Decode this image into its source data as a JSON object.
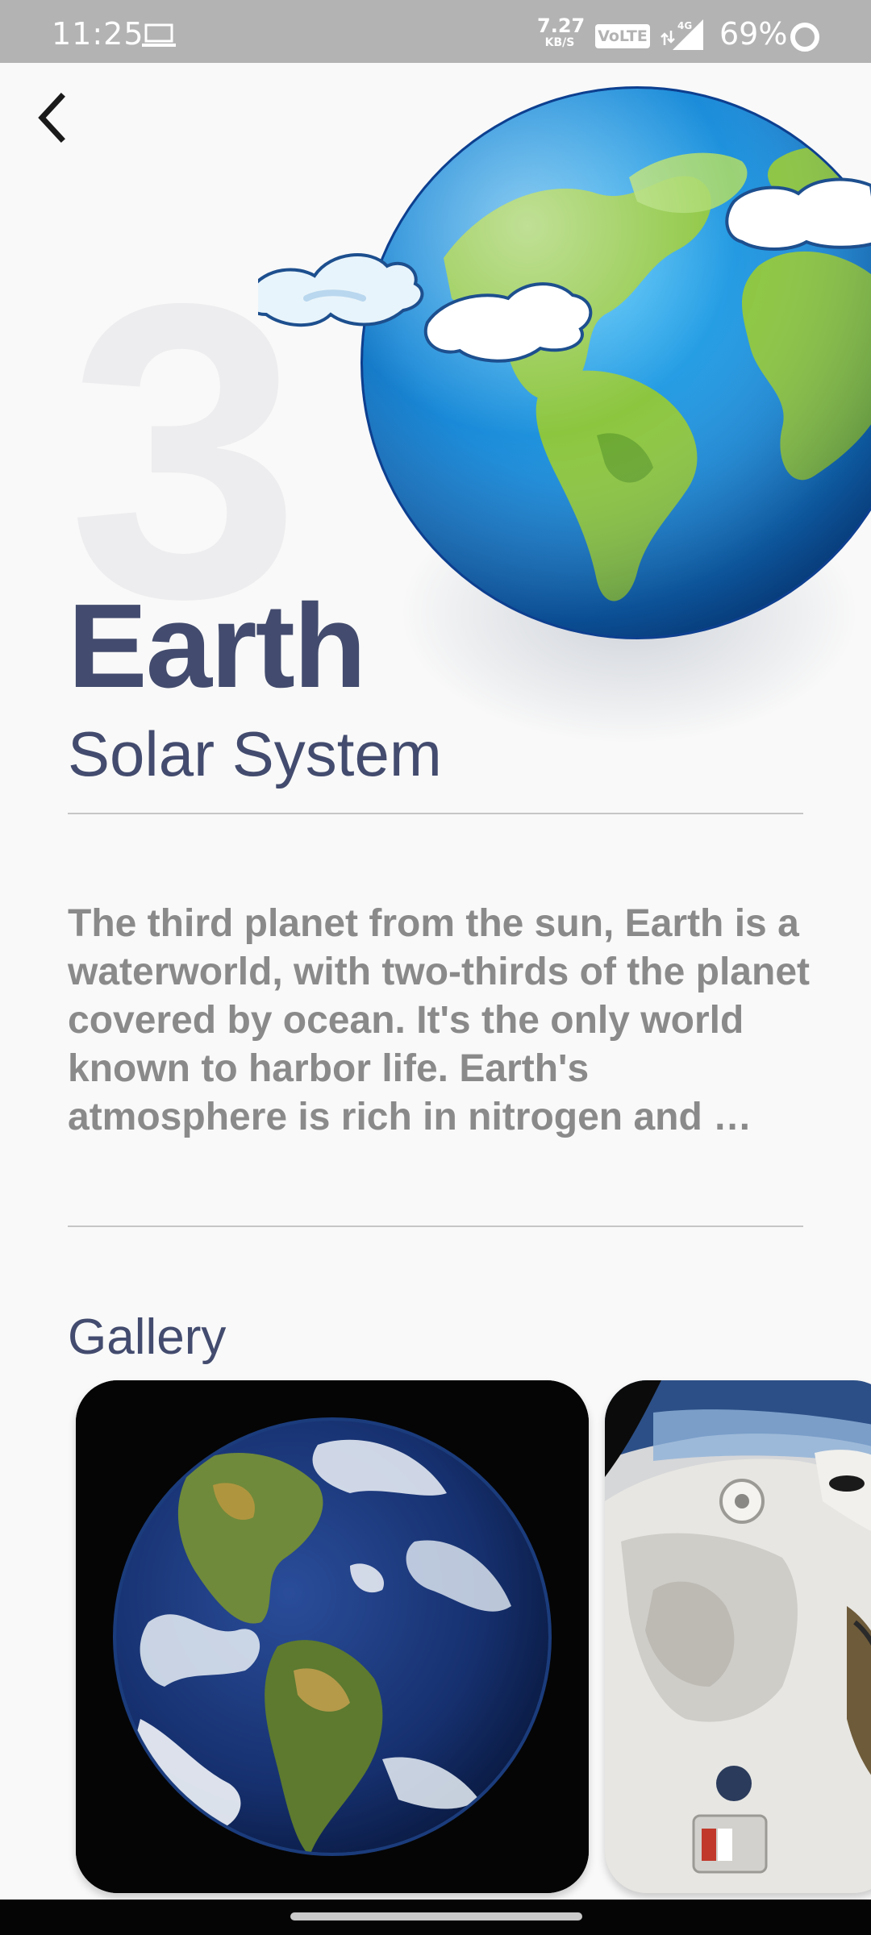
{
  "status_bar": {
    "time": "11:25",
    "net_speed_value": "7.27",
    "net_speed_unit": "KB/S",
    "volte": "VoLTE",
    "network": "4G",
    "battery": "69%",
    "icons": [
      "laptop-icon",
      "signal-icon",
      "battery-ring-icon"
    ]
  },
  "header": {
    "back_icon": "chevron-left-icon"
  },
  "planet": {
    "position_number": "3",
    "name": "Earth",
    "system": "Solar System",
    "illustration": "earth-illustration",
    "description": "The third planet from the sun, Earth is a waterworld, with two-thirds of the planet covered by ocean. It's the only world known to harbor life. Earth's atmosphere is rich in nitrogen and …"
  },
  "gallery": {
    "title": "Gallery",
    "items": [
      "earth-photo",
      "astronaut-photo"
    ]
  },
  "colors": {
    "title": "#434c6e",
    "body_text": "#8a8a8a",
    "background": "#f9f9f9",
    "status_bar": "#b3b3b3",
    "ocean": "#1e8fe0",
    "land": "#8cc63f"
  }
}
